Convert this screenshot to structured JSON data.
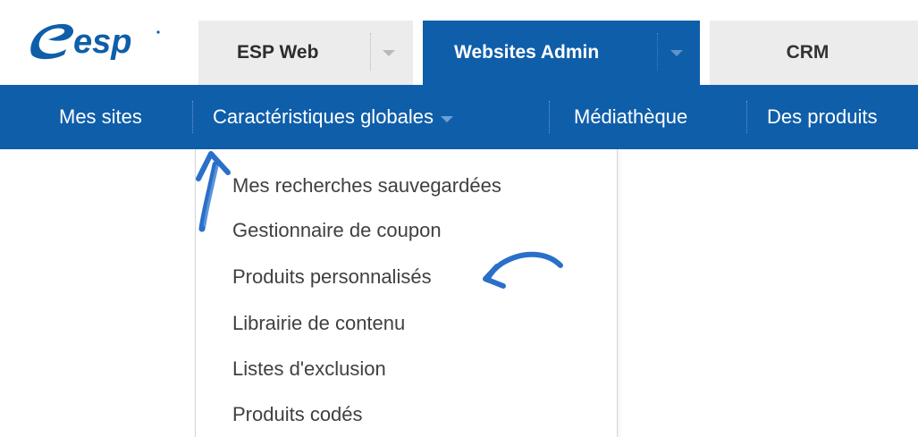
{
  "brand": {
    "logo_text": "esp",
    "accent": "#0f5eaa"
  },
  "tabs": [
    {
      "label": "ESP Web",
      "active": false,
      "has_dropdown": true
    },
    {
      "label": "Websites Admin",
      "active": true,
      "has_dropdown": true
    },
    {
      "label": "CRM",
      "active": false,
      "has_dropdown": false
    }
  ],
  "nav": {
    "items": [
      {
        "label": "Mes sites"
      },
      {
        "label": "Caractéristiques globales",
        "has_dropdown": true,
        "expanded": true
      },
      {
        "label": "Médiathèque"
      },
      {
        "label": "Des produits"
      }
    ]
  },
  "dropdown": {
    "items": [
      {
        "label": "Mes recherches sauvegardées"
      },
      {
        "label": "Gestionnaire de coupon"
      },
      {
        "label": "Produits personnalisés",
        "highlighted_by_annotation": true
      },
      {
        "label": "Librairie de contenu"
      },
      {
        "label": "Listes d'exclusion"
      },
      {
        "label": "Produits codés"
      }
    ]
  },
  "annotations": {
    "color": "#2a6fc9",
    "items": [
      "up-arrow",
      "curved-arrow"
    ]
  }
}
